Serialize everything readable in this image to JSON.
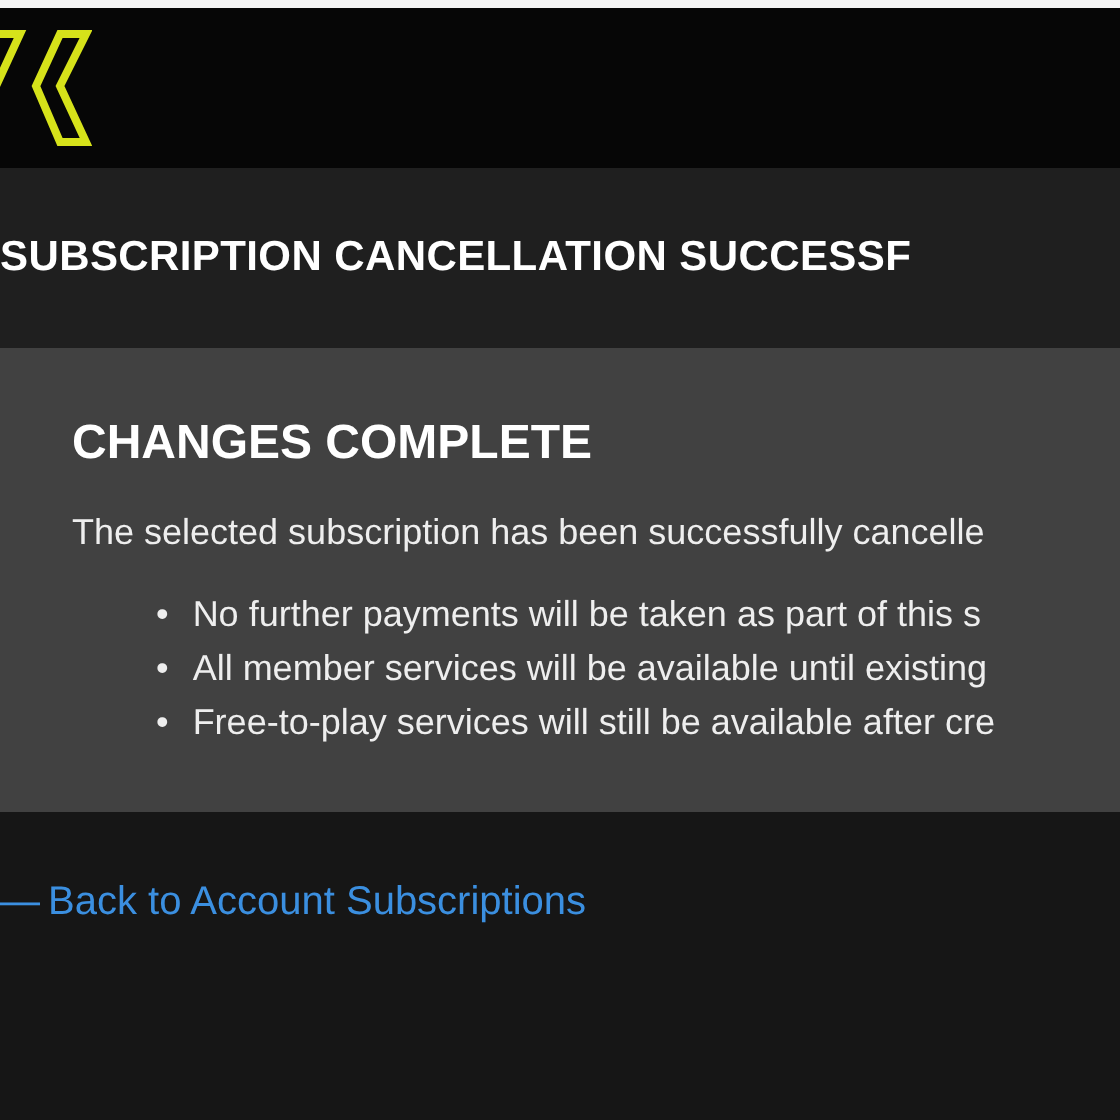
{
  "page_title": "SUBSCRIPTION CANCELLATION SUCCESSF",
  "panel": {
    "heading": "CHANGES COMPLETE",
    "message": "The selected subscription has been successfully cancelle",
    "bullets": [
      {
        "marker": "•",
        "text": "No further payments will be taken as part of this s"
      },
      {
        "marker": "•",
        "text": "All member services will be available until existing"
      },
      {
        "marker": "•",
        "text": "Free-to-play services will still be available after cre"
      }
    ]
  },
  "back_link": {
    "arrow": "—",
    "label": "Back to Account Subscriptions"
  }
}
